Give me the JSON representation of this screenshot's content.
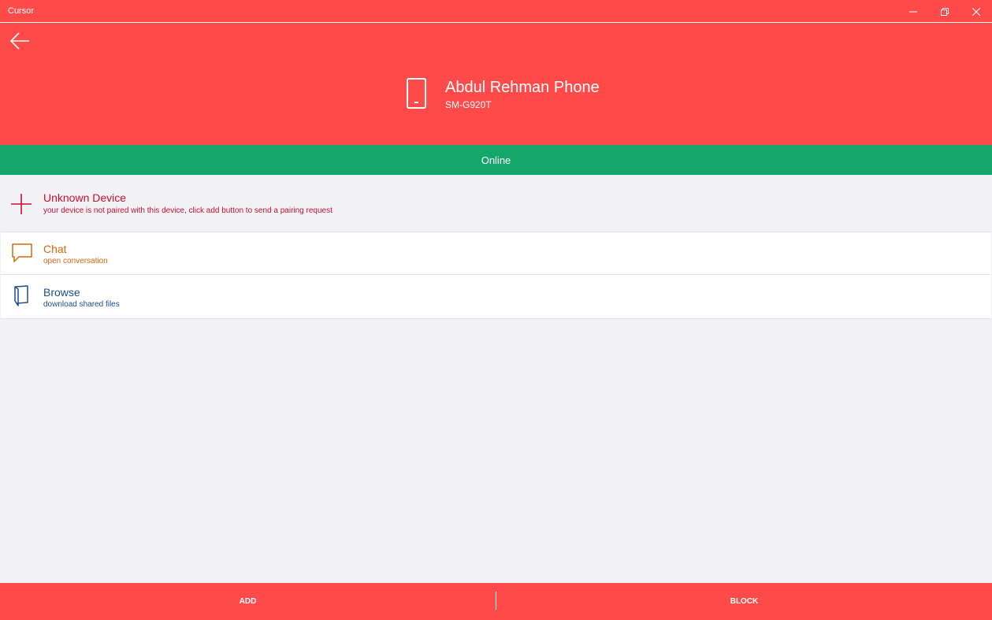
{
  "window": {
    "title": "Cursor",
    "controls": [
      "minimize-icon",
      "restore-icon",
      "close-icon"
    ]
  },
  "header": {
    "device_name": "Abdul Rehman Phone",
    "device_model": "SM-G920T",
    "icons": {
      "back": "arrow-left-icon",
      "device": "phone-icon"
    }
  },
  "status": {
    "label": "Online"
  },
  "rows": [
    {
      "title": "Unknown Device",
      "subtitle": "your device is not paired with this device, click add button to send a pairing request",
      "icon": "plus-icon"
    },
    {
      "title": "Chat",
      "subtitle": "open conversation",
      "icon": "chat-bubble-icon"
    },
    {
      "title": "Browse",
      "subtitle": "download shared files",
      "icon": "book-icon"
    }
  ],
  "actions": {
    "add": "ADD",
    "block": "BLOCK"
  },
  "colors": {
    "accent": "#ff4a4a",
    "online": "#13a86a",
    "unknown": "#c8102e",
    "chat": "#d9660f",
    "browse": "#1f4e8c",
    "background": "#f2f2f6"
  }
}
